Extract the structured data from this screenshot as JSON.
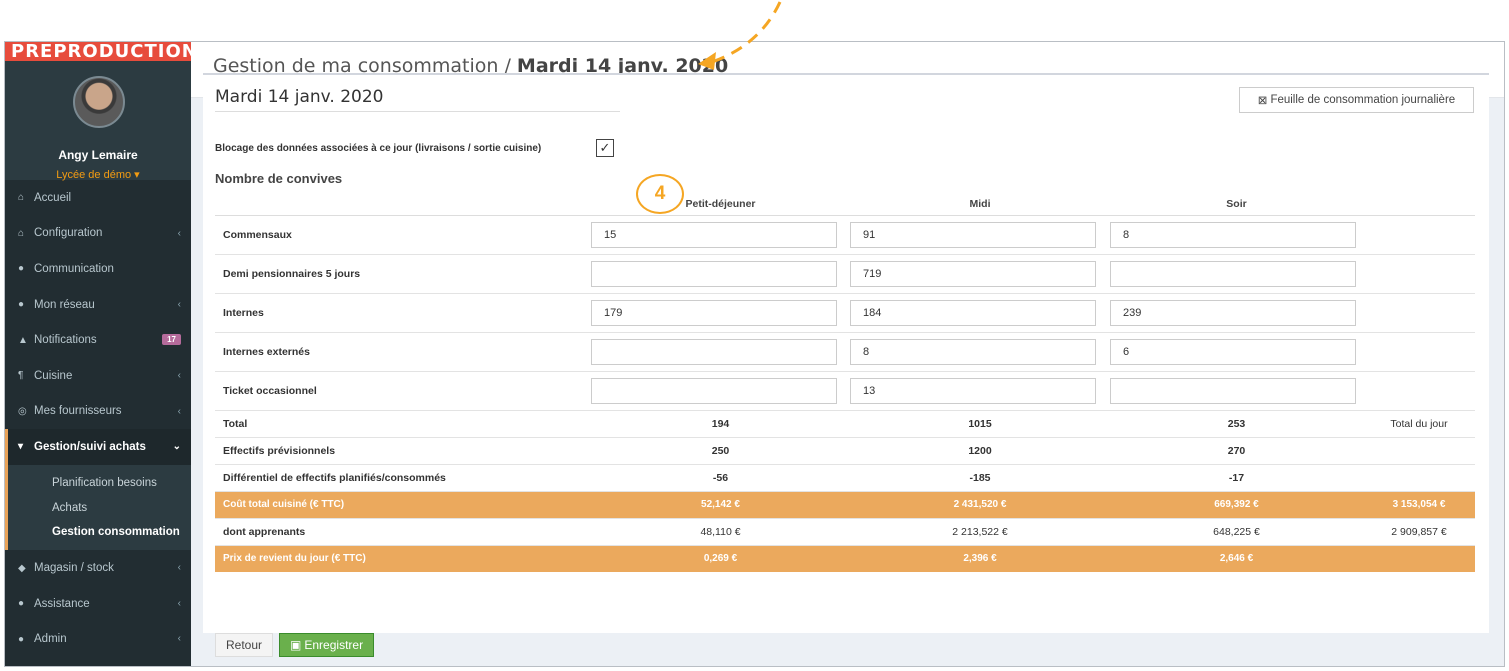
{
  "env_badge": "PREPRODUCTION",
  "user": {
    "name": "Angy Lemaire",
    "org": "Lycée de démo ▾"
  },
  "sidebar": {
    "items": [
      {
        "label": "Accueil",
        "icon": "⌂",
        "chev": ""
      },
      {
        "label": "Configuration",
        "icon": "⌂",
        "chev": "‹"
      },
      {
        "label": "Communication",
        "icon": "●",
        "chev": ""
      },
      {
        "label": "Mon réseau",
        "icon": "●",
        "chev": "‹"
      },
      {
        "label": "Notifications",
        "icon": "▲",
        "badge": "17"
      },
      {
        "label": "Cuisine",
        "icon": "¶",
        "chev": "‹"
      },
      {
        "label": "Mes fournisseurs",
        "icon": "◎",
        "chev": "‹"
      },
      {
        "label": "Gestion/suivi achats",
        "icon": "▾",
        "chev": "⌄"
      },
      {
        "label": "Magasin / stock",
        "icon": "◆",
        "chev": "‹"
      },
      {
        "label": "Assistance",
        "icon": "●",
        "chev": "‹"
      },
      {
        "label": "Admin",
        "icon": "●",
        "chev": "‹"
      }
    ],
    "submenu": [
      "Planification besoins",
      "Achats",
      "Gestion consommation"
    ]
  },
  "header": {
    "title_prefix": "Gestion de ma consommation / ",
    "title_date": "Mardi 14 janv. 2020"
  },
  "box": {
    "title": "Mardi 14 janv. 2020",
    "sheet_button": "Feuille de consommation journalière",
    "lock_label": "Blocage des données associées à ce jour (livraisons / sortie cuisine)",
    "lock_checked": "✓",
    "section": "Nombre de convives",
    "columns": [
      "Petit-déjeuner",
      "Midi",
      "Soir"
    ],
    "rows": [
      {
        "label": "Commensaux",
        "values": [
          "15",
          "91",
          "8"
        ]
      },
      {
        "label": "Demi pensionnaires 5 jours",
        "values": [
          "",
          "719",
          ""
        ]
      },
      {
        "label": "Internes",
        "values": [
          "179",
          "184",
          "239"
        ]
      },
      {
        "label": "Internes externés",
        "values": [
          "",
          "8",
          "6"
        ]
      },
      {
        "label": "Ticket occasionnel",
        "values": [
          "",
          "13",
          ""
        ]
      }
    ],
    "total": {
      "label": "Total",
      "values": [
        "194",
        "1015",
        "253"
      ],
      "extra": "Total du jour"
    },
    "forecast": {
      "label": "Effectifs prévisionnels",
      "values": [
        "250",
        "1200",
        "270"
      ]
    },
    "diff": {
      "label": "Différentiel de effectifs planifiés/consommés",
      "values": [
        "-56",
        "-185",
        "-17"
      ]
    },
    "cost": {
      "label": "Coût total cuisiné (€ TTC)",
      "values": [
        "52,142 €",
        "2 431,520 €",
        "669,392 €"
      ],
      "extra": "3 153,054 €"
    },
    "learners": {
      "label": "dont apprenants",
      "values": [
        "48,110 €",
        "2 213,522 €",
        "648,225 €"
      ],
      "extra": "2 909,857 €"
    },
    "unit_cost": {
      "label": "Prix de revient du jour (€ TTC)",
      "values": [
        "0,269 €",
        "2,396 €",
        "2,646 €"
      ]
    }
  },
  "actions": {
    "back": "Retour",
    "save": "Enregistrer"
  },
  "annotation": {
    "step": "4",
    "color": "#f5a623"
  }
}
